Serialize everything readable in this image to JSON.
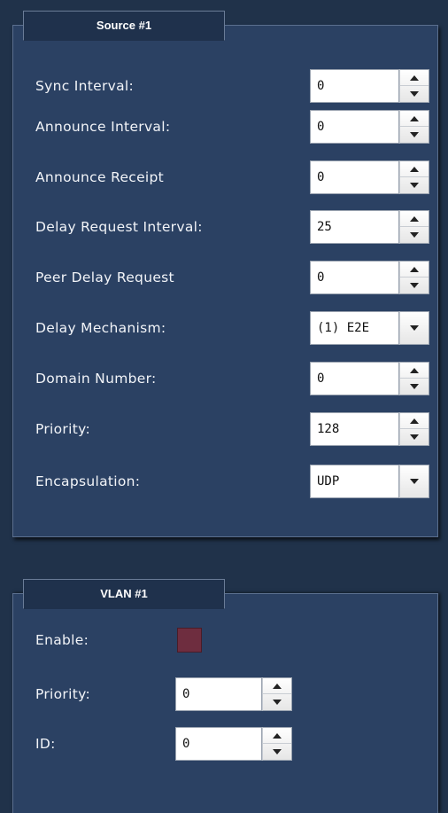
{
  "source": {
    "tab_label": "Source #1",
    "rows": [
      {
        "label": "Sync Interval:",
        "value": "0",
        "control": "spinner"
      },
      {
        "label": "Announce Interval:",
        "value": "0",
        "control": "spinner"
      },
      {
        "label": "Announce Receipt",
        "value": "0",
        "control": "spinner"
      },
      {
        "label": "Delay Request Interval:",
        "value": "25",
        "control": "spinner"
      },
      {
        "label": "Peer Delay Request",
        "value": "0",
        "control": "spinner"
      },
      {
        "label": "Delay Mechanism:",
        "value": "(1) E2E",
        "control": "select"
      },
      {
        "label": "Domain Number:",
        "value": "0",
        "control": "spinner"
      },
      {
        "label": "Priority:",
        "value": "128",
        "control": "spinner"
      },
      {
        "label": "Encapsulation:",
        "value": "UDP",
        "control": "select"
      }
    ]
  },
  "vlan": {
    "tab_label": "VLAN #1",
    "enable_label": "Enable:",
    "enable_checked": false,
    "enable_color": "#6e2d3f",
    "priority_label": "Priority:",
    "priority_value": "0",
    "id_label": "ID:",
    "id_value": "0"
  },
  "colors": {
    "background": "#20324a",
    "panel": "#2b4163",
    "tab": "#1f314c"
  }
}
